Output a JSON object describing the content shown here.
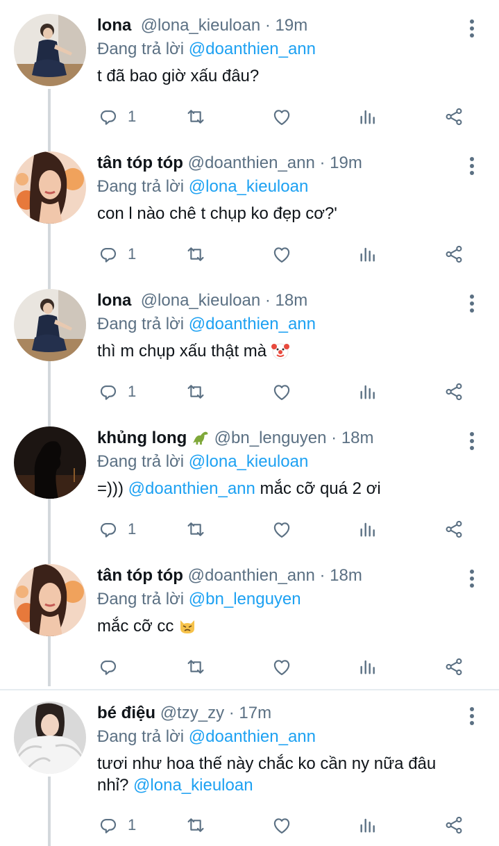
{
  "replying_prefix": "Đang trả lời",
  "tweets": [
    {
      "name": "lona",
      "handle": "@lona_kieuloan",
      "sep": "·",
      "time": "19m",
      "reply_to": "@doanthien_ann",
      "text": "t đã bao giờ xấu đâu?",
      "reply_count": "1",
      "avatar_icon": "avatar-lona"
    },
    {
      "name": "tân tóp tóp",
      "handle": "@doanthien_ann",
      "sep": "·",
      "time": "19m",
      "reply_to": "@lona_kieuloan",
      "text": "con l nào chê t chụp ko đẹp cơ?'",
      "reply_count": "1",
      "avatar_icon": "avatar-tan"
    },
    {
      "name": "lona",
      "handle": "@lona_kieuloan",
      "sep": "·",
      "time": "18m",
      "reply_to": "@doanthien_ann",
      "text": "thì m chụp xấu thật mà",
      "text_emoji": "clown-emoji",
      "reply_count": "1",
      "avatar_icon": "avatar-lona"
    },
    {
      "name": "khủng long",
      "name_emoji": "dinosaur-emoji",
      "handle": "@bn_lenguyen",
      "sep": "·",
      "time": "18m",
      "reply_to": "@lona_kieuloan",
      "text_prefix": "=)))",
      "text_mention": "@doanthien_ann",
      "text_suffix": "mắc cỡ quá 2 ơi",
      "reply_count": "1",
      "avatar_icon": "avatar-silhouette"
    },
    {
      "name": "tân tóp tóp",
      "handle": "@doanthien_ann",
      "sep": "·",
      "time": "18m",
      "reply_to": "@bn_lenguyen",
      "text": "mắc cỡ cc",
      "text_emoji": "pouting-cat-emoji",
      "reply_count": "",
      "avatar_icon": "avatar-tan"
    },
    {
      "name": "bé điệu",
      "handle": "@tzy_zy",
      "sep": "·",
      "time": "17m",
      "reply_to": "@doanthien_ann",
      "text_line1": "tươi như hoa thế này chắc ko cần ny nữa đâu",
      "text_line2_prefix": "nhỉ?",
      "text_mention": "@lona_kieuloan",
      "reply_count": "1",
      "avatar_icon": "avatar-fur"
    }
  ],
  "colors": {
    "link": "#1da1f2",
    "muted": "#5b7083",
    "thread_line": "#d3d8dc"
  }
}
